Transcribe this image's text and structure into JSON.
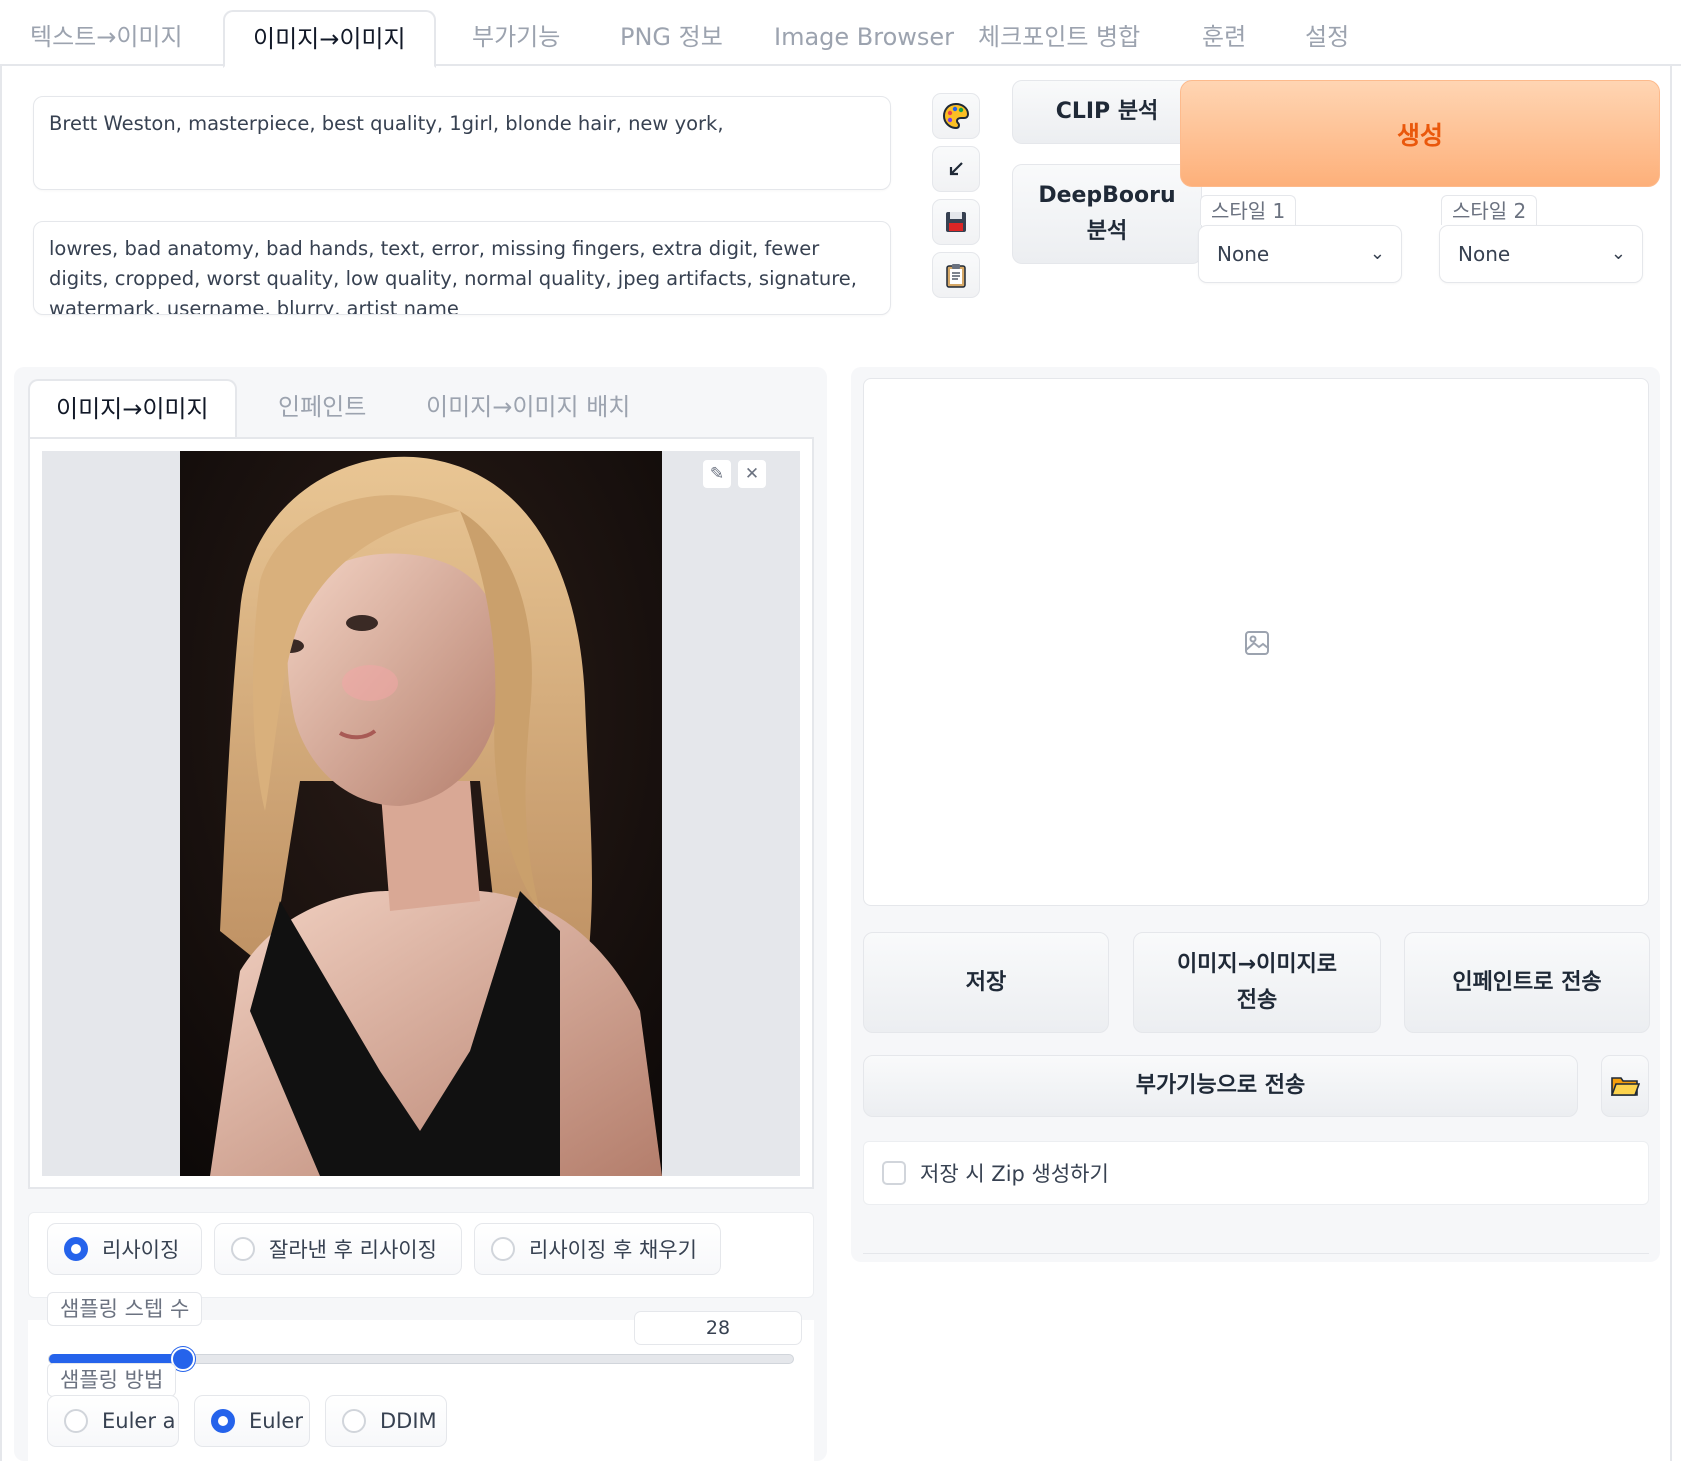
{
  "top_tabs": [
    {
      "label": "텍스트→이미지"
    },
    {
      "label": "이미지→이미지"
    },
    {
      "label": "부가기능"
    },
    {
      "label": "PNG 정보"
    },
    {
      "label": "Image Browser"
    },
    {
      "label": "체크포인트 병합"
    },
    {
      "label": "훈련"
    },
    {
      "label": "설정"
    }
  ],
  "prompt": {
    "positive": "Brett Weston, masterpiece, best quality, 1girl, blonde hair, new york,",
    "negative": "lowres, bad anatomy, bad hands, text, error, missing fingers, extra digit, fewer digits, cropped, worst quality, low quality, normal quality, jpeg artifacts, signature, watermark, username, blurry, artist name"
  },
  "tool_icons": [
    "palette-icon",
    "arrow-icon",
    "save-icon",
    "clipboard-icon"
  ],
  "buttons": {
    "clip": "CLIP 분석",
    "deepbooru_line1": "DeepBooru",
    "deepbooru_line2": "분석",
    "generate": "생성"
  },
  "styles": {
    "style1_label": "스타일 1",
    "style1_value": "None",
    "style2_label": "스타일 2",
    "style2_value": "None"
  },
  "sub_tabs": [
    {
      "label": "이미지→이미지"
    },
    {
      "label": "인페인트"
    },
    {
      "label": "이미지→이미지 배치"
    }
  ],
  "resize_modes": [
    {
      "label": "리사이징",
      "selected": true
    },
    {
      "label": "잘라낸 후 리사이징",
      "selected": false
    },
    {
      "label": "리사이징 후 채우기",
      "selected": false
    }
  ],
  "sampling_steps": {
    "label": "샘플링 스텝 수",
    "value": "28",
    "fraction": 0.18
  },
  "sampler": {
    "label": "샘플링 방법",
    "options": [
      {
        "label": "Euler a",
        "selected": false
      },
      {
        "label": "Euler",
        "selected": true
      },
      {
        "label": "DDIM",
        "selected": false
      }
    ]
  },
  "output": {
    "save": "저장",
    "send_img2img_line1": "이미지→이미지로",
    "send_img2img_line2": "전송",
    "send_inpaint": "인페인트로 전송",
    "send_extras": "부가기능으로 전송",
    "zip_label": "저장 시 Zip 생성하기"
  },
  "colors": {
    "accent": "#2563eb",
    "generate_bg": "#fdba8c",
    "generate_text": "#ea580c"
  }
}
